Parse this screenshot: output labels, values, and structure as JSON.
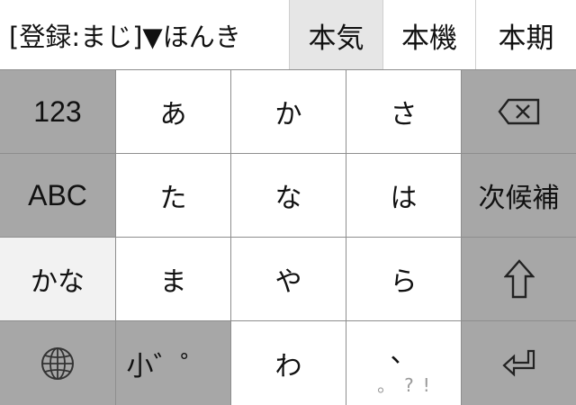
{
  "candidates": {
    "register": "[登録:まじ]▼ほんき",
    "items": [
      "本気",
      "本機",
      "本期"
    ],
    "selected_index": 0
  },
  "keyboard": {
    "numbers": "123",
    "abc": "ABC",
    "kana_mode": "かな",
    "row1": [
      "あ",
      "か",
      "さ"
    ],
    "row2": [
      "た",
      "な",
      "は"
    ],
    "row3": [
      "ま",
      "や",
      "ら"
    ],
    "wa": "わ",
    "dakuten": "小゛゜",
    "punct_main": "、",
    "punct_sub": "。?!",
    "convert": "次候補",
    "icons": {
      "globe": "globe-icon",
      "backspace": "backspace-icon",
      "shift": "shift-arrow-icon",
      "enter": "return-icon"
    }
  },
  "colors": {
    "key_white": "#ffffff",
    "key_gray": "#a7a7a7",
    "key_active_mode": "#f2f2f2",
    "candidate_selected": "#e6e6e6"
  }
}
